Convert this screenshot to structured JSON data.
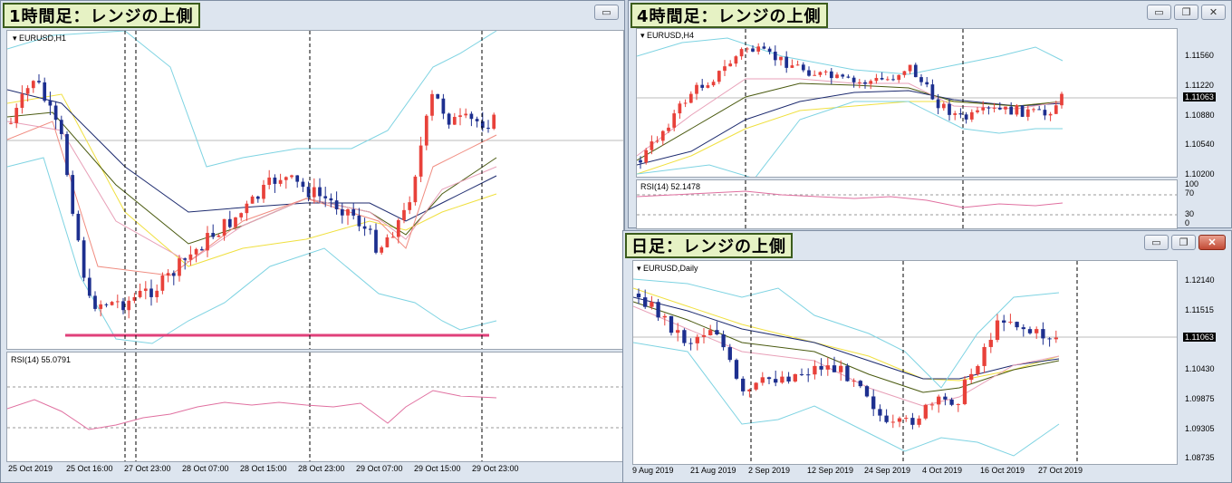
{
  "colors": {
    "up": "#e8413a",
    "down": "#1d2f8f",
    "bb": "#7ed3e2",
    "ma_yellow": "#f0e040",
    "ma_navy": "#1c2a6e",
    "ma_olive": "#4a5a10",
    "ma_pink": "#e8a0b8",
    "ma_red": "#f08c80",
    "support": "#e0407a",
    "rsi": "#e070a0",
    "grid": "#999999"
  },
  "h1": {
    "title": "1時間足：レンジの上側",
    "symbol": "EURUSD,H1",
    "rsi_label": "RSI(14) 55.0791",
    "xlabels": [
      "25 Oct 2019",
      "25 Oct 16:00",
      "27 Oct 23:00",
      "28 Oct 07:00",
      "28 Oct 15:00",
      "28 Oct 23:00",
      "29 Oct 07:00",
      "29 Oct 15:00",
      "29 Oct 23:00"
    ]
  },
  "h4": {
    "title": "4時間足：レンジの上側",
    "symbol": "EURUSD,H4",
    "rsi_label": "RSI(14) 52.1478",
    "price_labels": [
      "1.11560",
      "1.11220",
      "1.10880",
      "1.10540",
      "1.10200"
    ],
    "current_price": "1.11063",
    "rsi_levels": [
      "100",
      "70",
      "30",
      "0"
    ]
  },
  "daily": {
    "title": "日足：レンジの上側",
    "symbol": "EURUSD,Daily",
    "price_labels": [
      "1.12140",
      "1.11515",
      "1.10430",
      "1.09875",
      "1.09305",
      "1.08735"
    ],
    "current_price": "1.11063",
    "xlabels": [
      "9 Aug 2019",
      "21 Aug 2019",
      "2 Sep 2019",
      "12 Sep 2019",
      "24 Sep 2019",
      "4 Oct 2019",
      "16 Oct 2019",
      "27 Oct 2019"
    ]
  },
  "buttons": {
    "minimize": "▭",
    "restore": "❐",
    "close": "✕"
  },
  "chart_data": [
    {
      "type": "candlestick",
      "name": "EURUSD,H1",
      "indicator": "RSI(14)",
      "indicator_value": 55.0791
    },
    {
      "type": "candlestick",
      "name": "EURUSD,H4",
      "indicator": "RSI(14)",
      "indicator_value": 52.1478,
      "current_price": 1.11063,
      "y_ticks": [
        1.1156,
        1.1122,
        1.1088,
        1.1054,
        1.102
      ]
    },
    {
      "type": "candlestick",
      "name": "EURUSD,Daily",
      "current_price": 1.11063,
      "y_ticks": [
        1.1214,
        1.11515,
        1.1043,
        1.09875,
        1.09305,
        1.08735
      ]
    }
  ]
}
